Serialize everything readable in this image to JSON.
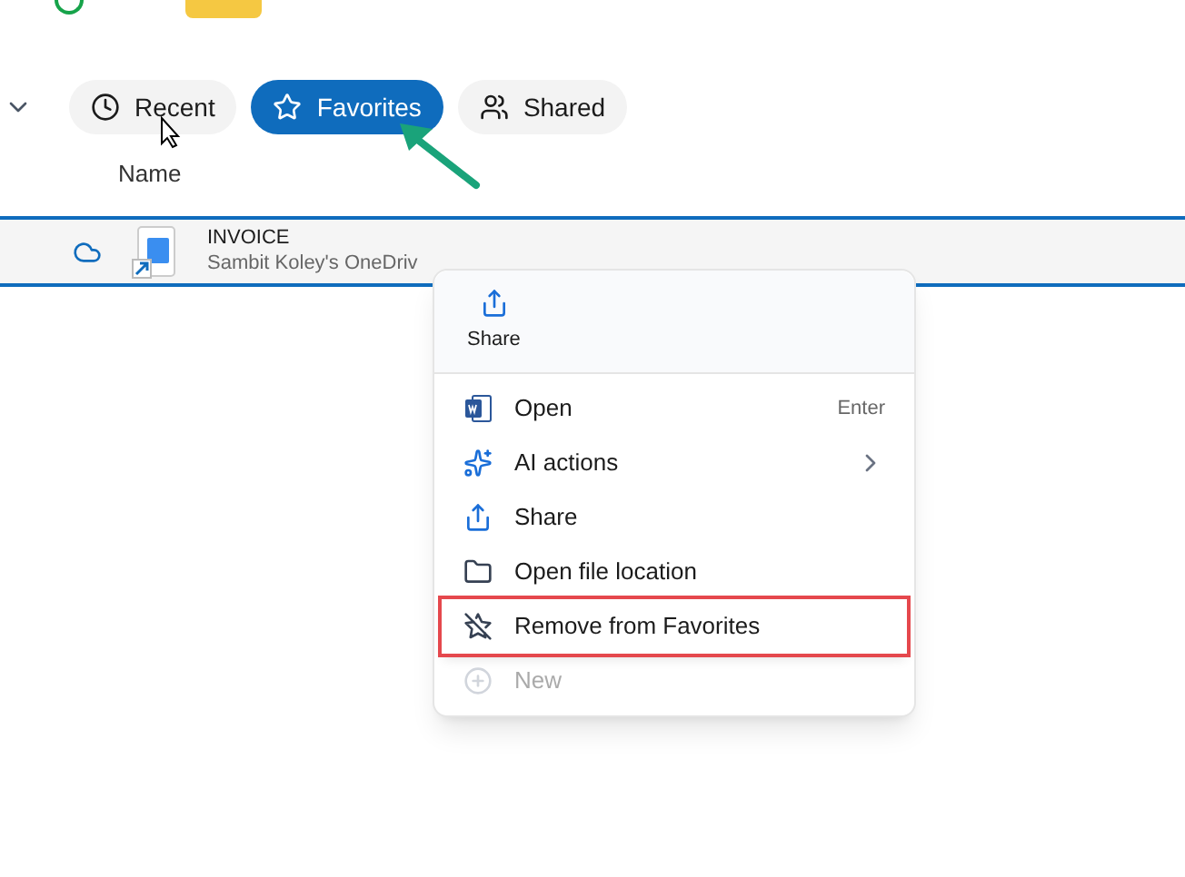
{
  "tabs": [
    {
      "label": "Recent",
      "selected": false
    },
    {
      "label": "Favorites",
      "selected": true
    },
    {
      "label": "Shared",
      "selected": false
    }
  ],
  "table": {
    "columns": [
      "Name"
    ],
    "rows": [
      {
        "name": "INVOICE",
        "location": "Sambit Koley's OneDriv",
        "selected": true
      }
    ]
  },
  "context_menu": {
    "top_action": "Share",
    "items": [
      {
        "label": "Open",
        "shortcut": "Enter",
        "submenu": false,
        "disabled": false,
        "highlighted": false
      },
      {
        "label": "AI actions",
        "submenu": true,
        "disabled": false,
        "highlighted": false
      },
      {
        "label": "Share",
        "submenu": false,
        "disabled": false,
        "highlighted": false
      },
      {
        "label": "Open file location",
        "submenu": false,
        "disabled": false,
        "highlighted": false
      },
      {
        "label": "Remove from Favorites",
        "submenu": false,
        "disabled": false,
        "highlighted": true
      },
      {
        "label": "New",
        "submenu": false,
        "disabled": true,
        "highlighted": false
      }
    ]
  }
}
